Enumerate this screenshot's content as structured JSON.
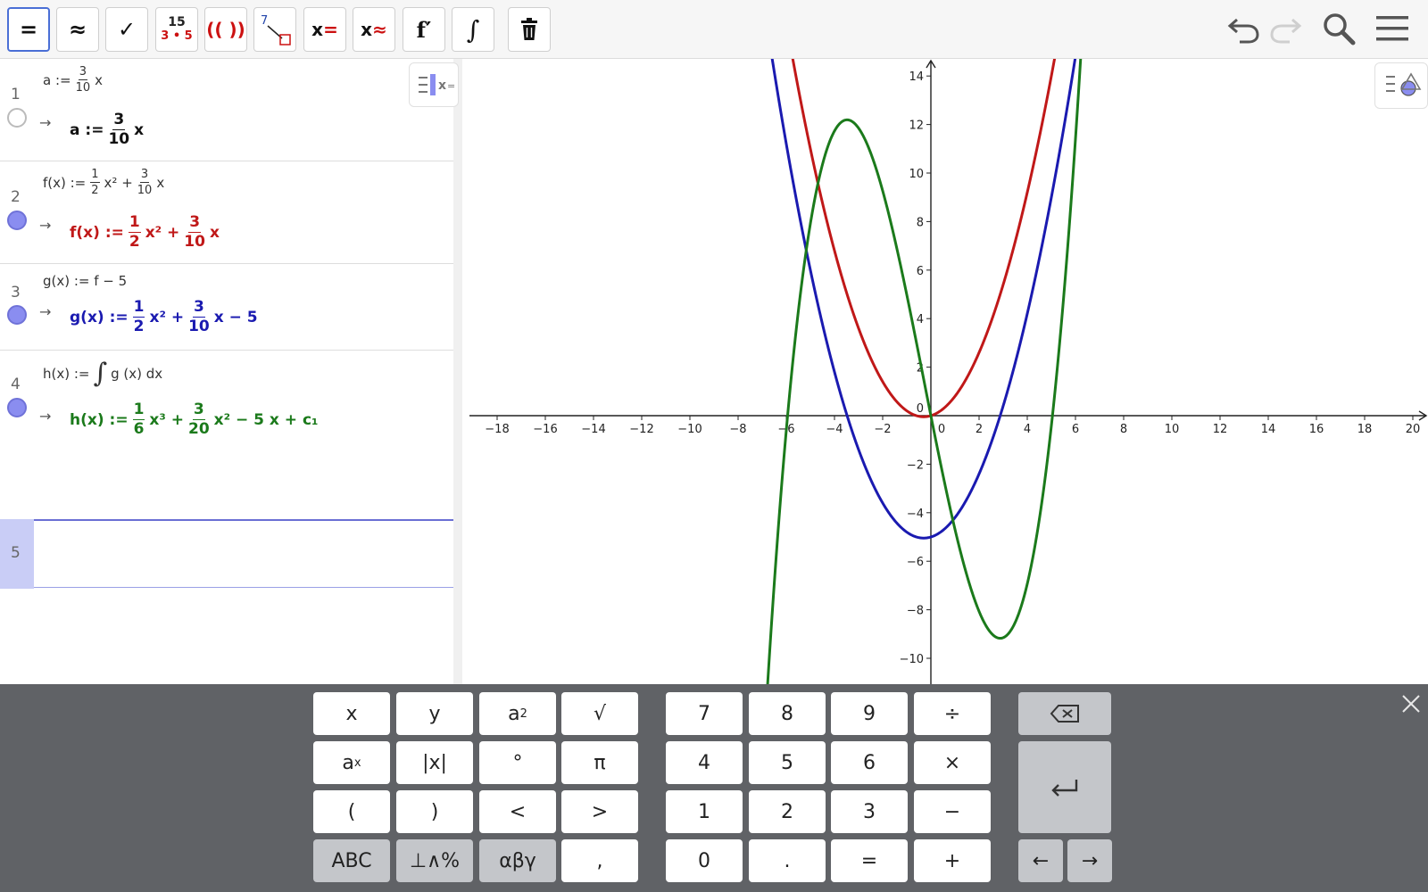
{
  "toolbar": {
    "tools": [
      {
        "name": "evaluate-tool",
        "label": "="
      },
      {
        "name": "numeric-tool",
        "label": "≈"
      },
      {
        "name": "keep-input-tool",
        "label": "✓"
      },
      {
        "name": "factor-number-tool",
        "label_top": "15",
        "label_bottom": "3 • 5"
      },
      {
        "name": "expand-tool",
        "label": "(( ))"
      },
      {
        "name": "substitute-tool",
        "label": "7"
      },
      {
        "name": "solve-tool",
        "label_x": "x",
        "label_op": "="
      },
      {
        "name": "nsolve-tool",
        "label_x": "x",
        "label_op": "≈"
      },
      {
        "name": "derivative-tool",
        "label": "f′"
      },
      {
        "name": "integral-tool",
        "label": "∫"
      },
      {
        "name": "delete-tool",
        "label": ""
      }
    ],
    "right_icons": [
      "undo-icon",
      "redo-icon",
      "search-icon",
      "menu-icon"
    ]
  },
  "algebra": {
    "rows": [
      {
        "num": "1",
        "input": {
          "pre": "a :=",
          "frac_num": "3",
          "frac_den": "10",
          "post": "x"
        },
        "arrow": "→",
        "output": {
          "pre": "a :=",
          "frac_num": "3",
          "frac_den": "10",
          "post": "x"
        },
        "color": "#111111"
      },
      {
        "num": "2",
        "input": {
          "pre": "f(x) :=",
          "f1_num": "1",
          "f1_den": "2",
          "mid": "x² +",
          "f2_num": "3",
          "f2_den": "10",
          "post": "x"
        },
        "arrow": "→",
        "output": {
          "pre": "f(x) :=",
          "f1_num": "1",
          "f1_den": "2",
          "mid": "x² +",
          "f2_num": "3",
          "f2_den": "10",
          "post": "x"
        },
        "color": "#c01818"
      },
      {
        "num": "3",
        "input": {
          "text": "g(x) := f − 5"
        },
        "arrow": "→",
        "output": {
          "pre": "g(x) :=",
          "f1_num": "1",
          "f1_den": "2",
          "mid": "x² +",
          "f2_num": "3",
          "f2_den": "10",
          "post": "x − 5"
        },
        "color": "#1a1ab0"
      },
      {
        "num": "4",
        "input": {
          "pre": "h(x) :=",
          "integral": "∫",
          "post": "g (x) dx"
        },
        "arrow": "→",
        "output": {
          "pre": "h(x) :=",
          "f1_num": "1",
          "f1_den": "6",
          "mid": "x³ +",
          "f2_num": "3",
          "f2_den": "20",
          "post": "x² − 5 x + c₁"
        },
        "color": "#1b7a1b"
      }
    ],
    "active_row_num": "5"
  },
  "graph": {
    "x_ticks": [
      "−18",
      "−16",
      "−14",
      "−12",
      "−10",
      "−8",
      "−6",
      "−4",
      "−2",
      "0",
      "2",
      "4",
      "6",
      "8",
      "10",
      "12",
      "14",
      "16",
      "18",
      "20"
    ],
    "y_ticks": [
      "14",
      "12",
      "10",
      "8",
      "6",
      "4",
      "2",
      "0",
      "−2",
      "−4",
      "−6",
      "−8",
      "−10"
    ],
    "x_values": [
      -18,
      -16,
      -14,
      -12,
      -10,
      -8,
      -6,
      -4,
      -2,
      0,
      2,
      4,
      6,
      8,
      10,
      12,
      14,
      16,
      18,
      20
    ],
    "y_values": [
      14,
      12,
      10,
      8,
      6,
      4,
      2,
      0,
      -2,
      -4,
      -6,
      -8,
      -10
    ],
    "functions": [
      {
        "name": "f",
        "color": "#c01818"
      },
      {
        "name": "g",
        "color": "#1a1ab0"
      },
      {
        "name": "h",
        "color": "#1b7a1b"
      }
    ]
  },
  "keyboard": {
    "left_keys": [
      [
        "x",
        "y",
        "a²",
        "√"
      ],
      [
        "aˣ",
        "|x|",
        "°",
        "π"
      ],
      [
        "(",
        ")",
        "<",
        ">"
      ],
      [
        "ABC",
        "⊥∧%",
        "αβγ",
        ","
      ]
    ],
    "num_keys": [
      [
        "7",
        "8",
        "9",
        "÷"
      ],
      [
        "4",
        "5",
        "6",
        "×"
      ],
      [
        "1",
        "2",
        "3",
        "−"
      ],
      [
        "0",
        ".",
        "=",
        "+"
      ]
    ],
    "backspace": "⌫",
    "enter": "↵",
    "left_arrow": "←",
    "right_arrow": "→",
    "close": "×"
  },
  "colors": {
    "accent": "#4a6fd6",
    "f": "#c01818",
    "g": "#1a1ab0",
    "h": "#1b7a1b",
    "keyboard_bg": "#606266"
  }
}
